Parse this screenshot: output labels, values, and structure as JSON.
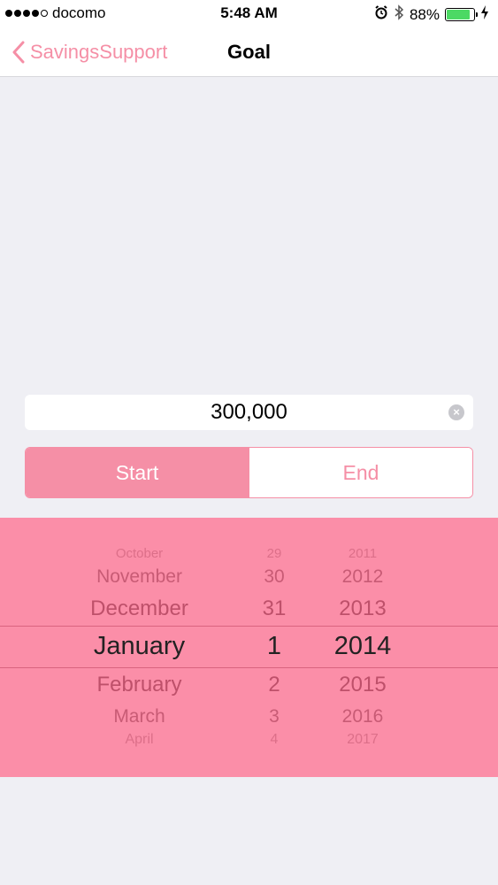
{
  "status_bar": {
    "carrier": "docomo",
    "time": "5:48 AM",
    "battery_percent": "88%",
    "battery_level": 0.88,
    "icons": [
      "signal-dots",
      "alarm-icon",
      "bluetooth-icon",
      "battery-icon",
      "charging-icon"
    ]
  },
  "nav": {
    "back_label": "SavingsSupport",
    "title": "Goal"
  },
  "amount": {
    "value": "300,000"
  },
  "segments": {
    "start_label": "Start",
    "end_label": "End",
    "selected": "Start"
  },
  "picker": {
    "rows": [
      {
        "month": "October",
        "day": "29",
        "year": "2011"
      },
      {
        "month": "November",
        "day": "30",
        "year": "2012"
      },
      {
        "month": "December",
        "day": "31",
        "year": "2013"
      },
      {
        "month": "January",
        "day": "1",
        "year": "2014"
      },
      {
        "month": "February",
        "day": "2",
        "year": "2015"
      },
      {
        "month": "March",
        "day": "3",
        "year": "2016"
      },
      {
        "month": "April",
        "day": "4",
        "year": "2017"
      }
    ]
  },
  "colors": {
    "accent": "#f58fa6",
    "picker_bg": "#fb8ea8",
    "background": "#efeff4"
  }
}
